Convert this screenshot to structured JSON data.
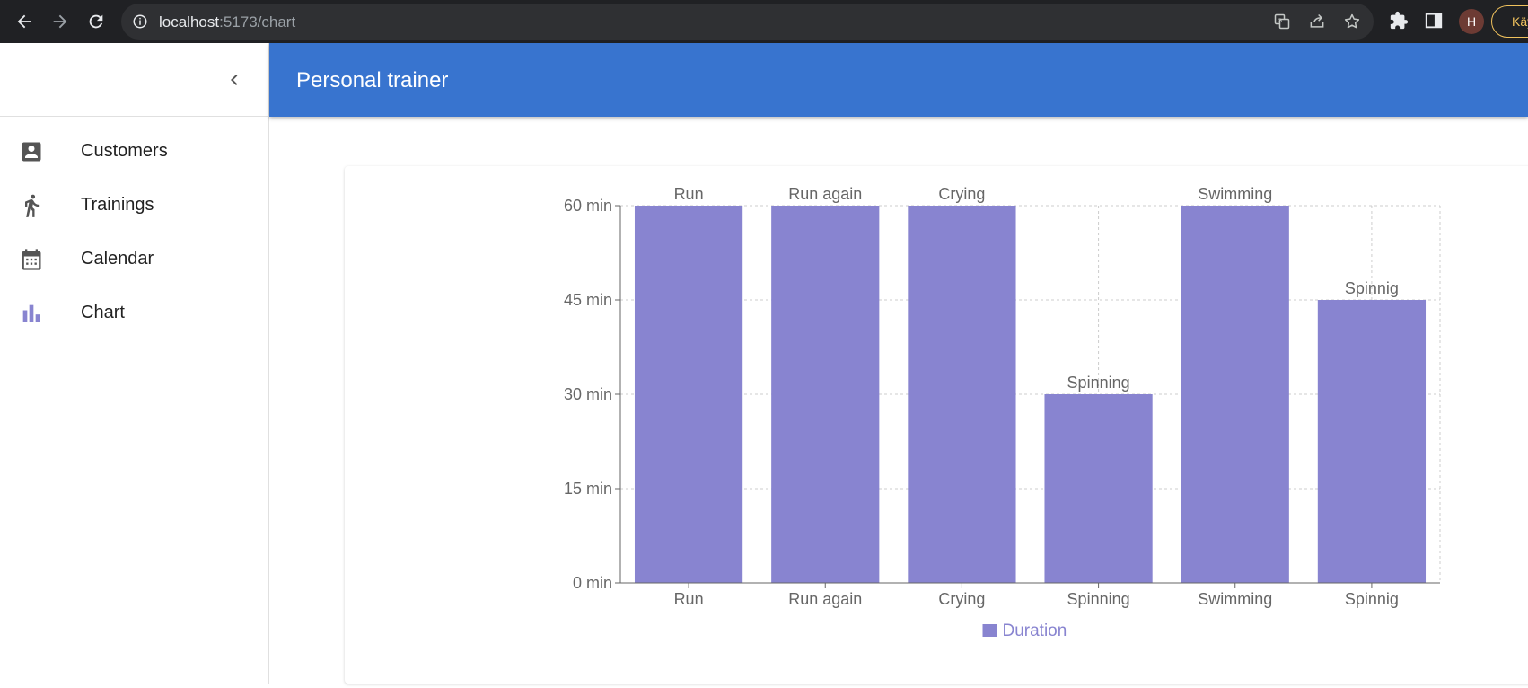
{
  "browser": {
    "url_host": "localhost",
    "url_path": ":5173/chart",
    "profile_initial": "H",
    "update_label": "Käyn"
  },
  "drawer": {
    "items": [
      {
        "label": "Customers",
        "icon": "account-box-icon"
      },
      {
        "label": "Trainings",
        "icon": "directions-run-icon"
      },
      {
        "label": "Calendar",
        "icon": "calendar-icon"
      },
      {
        "label": "Chart",
        "icon": "bar-chart-icon"
      }
    ]
  },
  "app_bar": {
    "title": "Personal trainer"
  },
  "colors": {
    "bar": "#8884d0",
    "app_bar": "#3874cf",
    "grid": "#cccccc",
    "axis_text": "#666666"
  },
  "chart_data": {
    "type": "bar",
    "categories": [
      "Run",
      "Run again",
      "Crying",
      "Spinning",
      "Swimming",
      "Spinnig"
    ],
    "series": [
      {
        "name": "Duration",
        "values": [
          60,
          60,
          60,
          30,
          60,
          45
        ]
      }
    ],
    "data_labels": [
      "Run",
      "Run again",
      "Crying",
      "Spinning",
      "Swimming",
      "Spinnig"
    ],
    "y_ticks": [
      0,
      15,
      30,
      45,
      60
    ],
    "y_tick_suffix": " min",
    "ylim": [
      0,
      60
    ],
    "grid": true,
    "legend_position": "bottom-center"
  }
}
